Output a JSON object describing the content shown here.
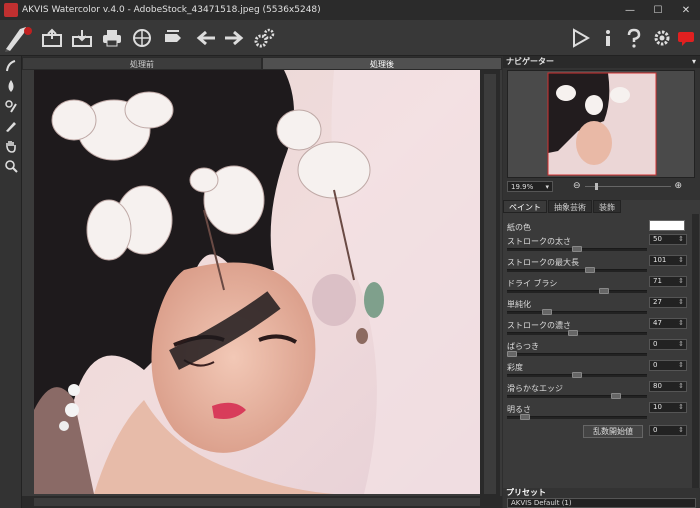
{
  "window": {
    "title": "AKVIS Watercolor v.4.0 - AdobeStock_43471518.jpeg (5536x5248)"
  },
  "view_tabs": [
    {
      "label": "処理前"
    },
    {
      "label": "処理後"
    }
  ],
  "navigator": {
    "title": "ナビゲーター",
    "zoom": "19.9%"
  },
  "settings_tabs": [
    {
      "label": "ペイント"
    },
    {
      "label": "抽象芸術"
    },
    {
      "label": "装飾"
    }
  ],
  "params": {
    "paper_color": {
      "label": "紙の色"
    },
    "stroke_thickness": {
      "label": "ストロークの太さ",
      "value": "50",
      "level": 0.5
    },
    "stroke_max_length": {
      "label": "ストロークの最大長",
      "value": "101",
      "level": 0.6
    },
    "dry_brush": {
      "label": "ドライ ブラシ",
      "value": "71",
      "level": 0.71
    },
    "simplification": {
      "label": "単純化",
      "value": "27",
      "level": 0.27
    },
    "stroke_density": {
      "label": "ストロークの濃さ",
      "value": "47",
      "level": 0.47
    },
    "unevenness": {
      "label": "ばらつき",
      "value": "0",
      "level": 0.0
    },
    "saturation": {
      "label": "彩度",
      "value": "0",
      "level": 0.5
    },
    "smooth_edges": {
      "label": "滑らかなエッジ",
      "value": "80",
      "level": 0.8
    },
    "brightness": {
      "label": "明るさ",
      "value": "10",
      "level": 0.1
    },
    "random_seed": {
      "label": "乱数開始値",
      "value": "0"
    }
  },
  "preset": {
    "title": "プリセット",
    "value": "AKVIS Default (1)"
  }
}
